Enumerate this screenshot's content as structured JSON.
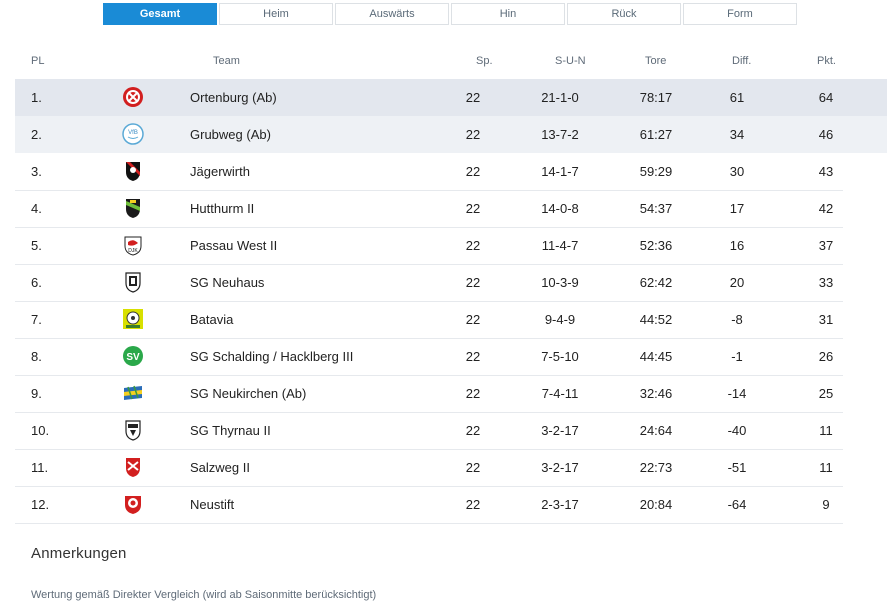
{
  "tabs": [
    "Gesamt",
    "Heim",
    "Auswärts",
    "Hin",
    "Rück",
    "Form"
  ],
  "active_tab": "Gesamt",
  "columns": {
    "pl": "PL",
    "team": "Team",
    "sp": "Sp.",
    "sun": "S-U-N",
    "tore": "Tore",
    "diff": "Diff.",
    "pkt": "Pkt."
  },
  "rows": [
    {
      "pl": "1.",
      "team": "Ortenburg (Ab)",
      "sp": "22",
      "sun": "21-1-0",
      "tore": "78:17",
      "diff": "61",
      "pkt": "64",
      "logo": "ortenburg-crest"
    },
    {
      "pl": "2.",
      "team": "Grubweg (Ab)",
      "sp": "22",
      "sun": "13-7-2",
      "tore": "61:27",
      "diff": "34",
      "pkt": "46",
      "logo": "grubweg-crest"
    },
    {
      "pl": "3.",
      "team": "Jägerwirth",
      "sp": "22",
      "sun": "14-1-7",
      "tore": "59:29",
      "diff": "30",
      "pkt": "43",
      "logo": "jaegerwirth-crest"
    },
    {
      "pl": "4.",
      "team": "Hutthurm II",
      "sp": "22",
      "sun": "14-0-8",
      "tore": "54:37",
      "diff": "17",
      "pkt": "42",
      "logo": "hutthurm-crest"
    },
    {
      "pl": "5.",
      "team": "Passau West II",
      "sp": "22",
      "sun": "11-4-7",
      "tore": "52:36",
      "diff": "16",
      "pkt": "37",
      "logo": "passau-west-crest"
    },
    {
      "pl": "6.",
      "team": "SG Neuhaus",
      "sp": "22",
      "sun": "10-3-9",
      "tore": "62:42",
      "diff": "20",
      "pkt": "33",
      "logo": "neuhaus-crest"
    },
    {
      "pl": "7.",
      "team": "Batavia",
      "sp": "22",
      "sun": "9-4-9",
      "tore": "44:52",
      "diff": "-8",
      "pkt": "31",
      "logo": "batavia-crest"
    },
    {
      "pl": "8.",
      "team": "SG Schalding / Hacklberg III",
      "sp": "22",
      "sun": "7-5-10",
      "tore": "44:45",
      "diff": "-1",
      "pkt": "26",
      "logo": "schalding-crest"
    },
    {
      "pl": "9.",
      "team": "SG Neukirchen (Ab)",
      "sp": "22",
      "sun": "7-4-11",
      "tore": "32:46",
      "diff": "-14",
      "pkt": "25",
      "logo": "neukirchen-crest"
    },
    {
      "pl": "10.",
      "team": "SG Thyrnau II",
      "sp": "22",
      "sun": "3-2-17",
      "tore": "24:64",
      "diff": "-40",
      "pkt": "11",
      "logo": "thyrnau-crest"
    },
    {
      "pl": "11.",
      "team": "Salzweg II",
      "sp": "22",
      "sun": "3-2-17",
      "tore": "22:73",
      "diff": "-51",
      "pkt": "11",
      "logo": "salzweg-crest"
    },
    {
      "pl": "12.",
      "team": "Neustift",
      "sp": "22",
      "sun": "2-3-17",
      "tore": "20:84",
      "diff": "-64",
      "pkt": "9",
      "logo": "neustift-crest"
    }
  ],
  "anmerkungen": {
    "title": "Anmerkungen",
    "text": "Wertung gemäß Direkter Vergleich (wird ab Saisonmitte berücksichtigt)"
  },
  "colors": {
    "accent": "#1a8bd6",
    "row_highlight": "#e3e7ee"
  }
}
